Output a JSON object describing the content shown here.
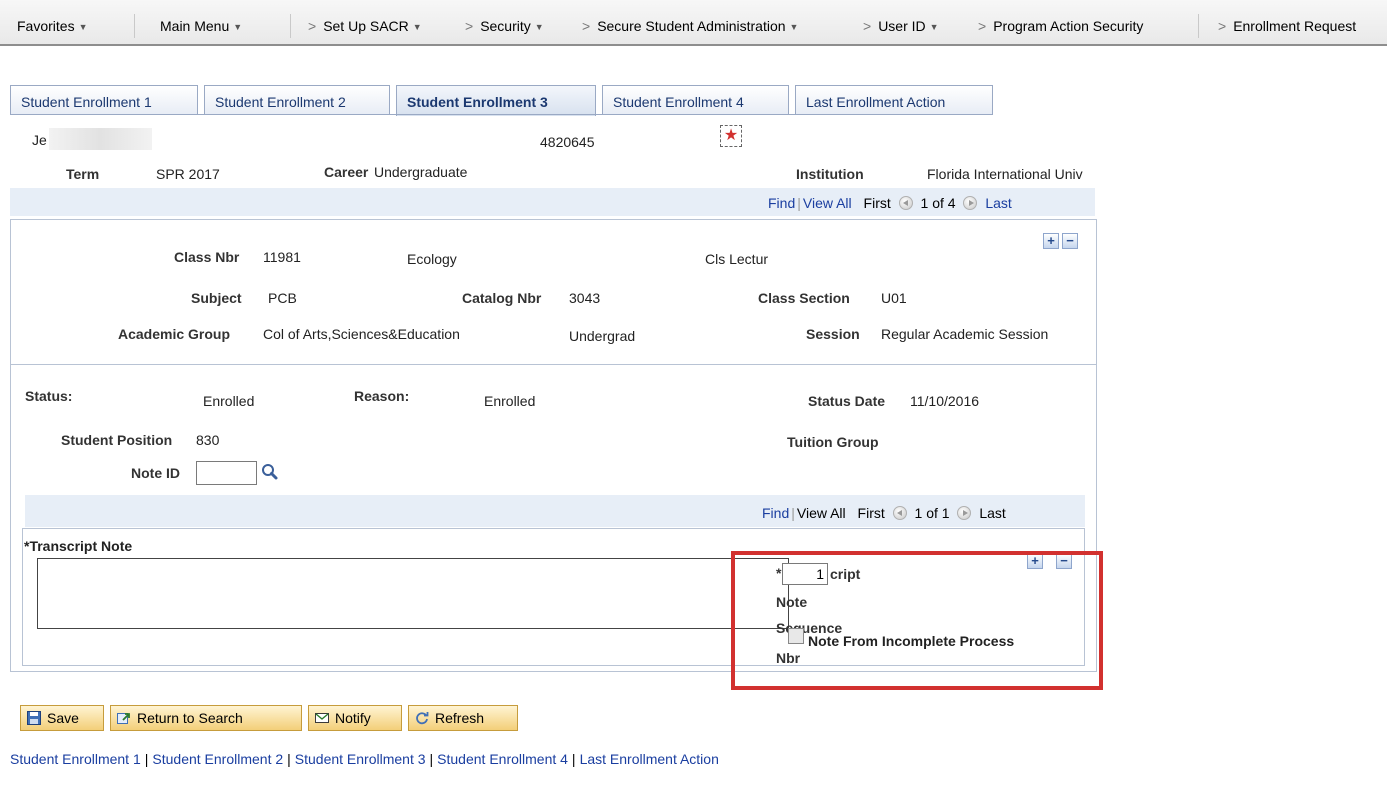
{
  "nav": {
    "favorites": "Favorites",
    "main_menu": "Main Menu",
    "breadcrumbs": [
      "Set Up SACR",
      "Security",
      "Secure Student Administration",
      "User ID",
      "Program Action Security",
      "Enrollment Request"
    ]
  },
  "tabs": [
    "Student Enrollment 1",
    "Student Enrollment 2",
    "Student Enrollment 3",
    "Student Enrollment 4",
    "Last Enrollment Action"
  ],
  "header": {
    "student_name": "Je",
    "student_id": "4820645",
    "term_label": "Term",
    "term_value": "SPR 2017",
    "career_label": "Career",
    "career_value": "Undergraduate",
    "institution_label": "Institution",
    "institution_value": "Florida International Univ"
  },
  "grid1": {
    "find": "Find",
    "view_all": "View All",
    "first": "First",
    "count": "1 of 4",
    "last": "Last"
  },
  "class": {
    "class_nbr_label": "Class Nbr",
    "class_nbr_value": "11981",
    "title": "Ecology",
    "component": "Cls Lectur",
    "subject_label": "Subject",
    "subject_value": "PCB",
    "catalog_label": "Catalog Nbr",
    "catalog_value": "3043",
    "section_label": "Class Section",
    "section_value": "U01",
    "acad_group_label": "Academic Group",
    "acad_group_value": "Col of Arts,Sciences&Education",
    "acad_level": "Undergrad",
    "session_label": "Session",
    "session_value": "Regular Academic Session"
  },
  "enrollment": {
    "status_label": "Status:",
    "status_value": "Enrolled",
    "reason_label": "Reason:",
    "reason_value": "Enrolled",
    "status_date_label": "Status Date",
    "status_date_value": "11/10/2016",
    "position_label": "Student Position",
    "position_value": "830",
    "tuition_label": "Tuition Group",
    "note_id_label": "Note ID",
    "note_id_value": ""
  },
  "grid2": {
    "find": "Find",
    "view_all": "View All",
    "first": "First",
    "count": "1 of 1",
    "last": "Last"
  },
  "transcript": {
    "note_label": "*Transcript Note",
    "note_value": "",
    "seq_label_1": "*",
    "seq_label_2": "cript",
    "seq_label_3": "Note",
    "seq_label_4": "Sequence",
    "seq_label_5": "Nbr",
    "seq_value": "1",
    "incomplete_label": "Note From Incomplete Process"
  },
  "buttons": {
    "save": "Save",
    "return": "Return to Search",
    "notify": "Notify",
    "refresh": "Refresh"
  },
  "footer_links": [
    "Student Enrollment 1",
    "Student Enrollment 2",
    "Student Enrollment 3",
    "Student Enrollment 4",
    "Last Enrollment Action"
  ],
  "colors": {
    "highlight": "#d2312f",
    "link": "#1a3ea0",
    "button": "#f3cf79"
  }
}
